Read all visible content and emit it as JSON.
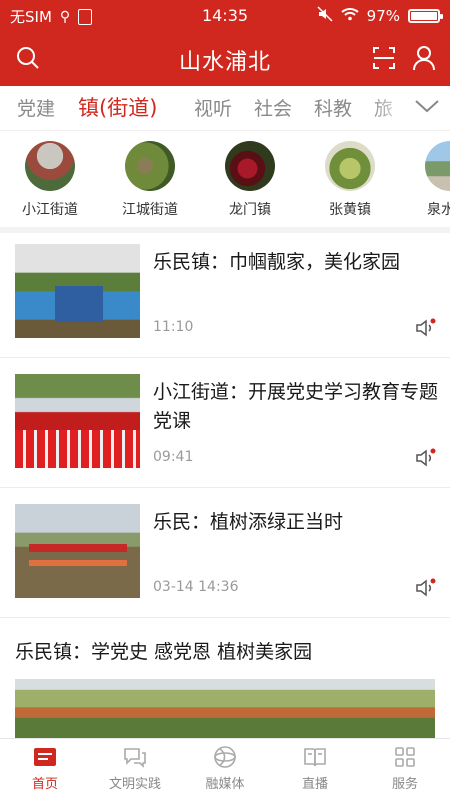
{
  "status": {
    "carrier": "无SIM",
    "time": "14:35",
    "battery": "97%",
    "battery_level": 0.97
  },
  "header": {
    "title": "山水浦北",
    "search_icon": "search-icon",
    "scan_icon": "scan-icon",
    "user_icon": "user-icon"
  },
  "tabs": [
    {
      "label": "党建"
    },
    {
      "label": "镇(街道)",
      "active": true
    },
    {
      "label": "视听"
    },
    {
      "label": "社会"
    },
    {
      "label": "科教"
    },
    {
      "label": "旅"
    }
  ],
  "regions": [
    {
      "label": "小江街道"
    },
    {
      "label": "江城街道"
    },
    {
      "label": "龙门镇"
    },
    {
      "label": "张黄镇"
    },
    {
      "label": "泉水"
    }
  ],
  "news": [
    {
      "title": "乐民镇：巾帼靓家，美化家园",
      "time": "11:10"
    },
    {
      "title": "小江街道：开展党史学习教育专题党课",
      "time": "09:41"
    },
    {
      "title": "乐民：植树添绿正当时",
      "time": "03-14 14:36"
    }
  ],
  "feature": {
    "title": "乐民镇：学党史 感党恩 植树美家园"
  },
  "bottom_nav": [
    {
      "label": "首页",
      "active": true,
      "icon": "home-icon"
    },
    {
      "label": "文明实践",
      "icon": "chat-icon"
    },
    {
      "label": "融媒体",
      "icon": "globe-icon"
    },
    {
      "label": "直播",
      "icon": "book-icon"
    },
    {
      "label": "服务",
      "icon": "grid-icon"
    }
  ],
  "colors": {
    "brand": "#d0281e"
  }
}
